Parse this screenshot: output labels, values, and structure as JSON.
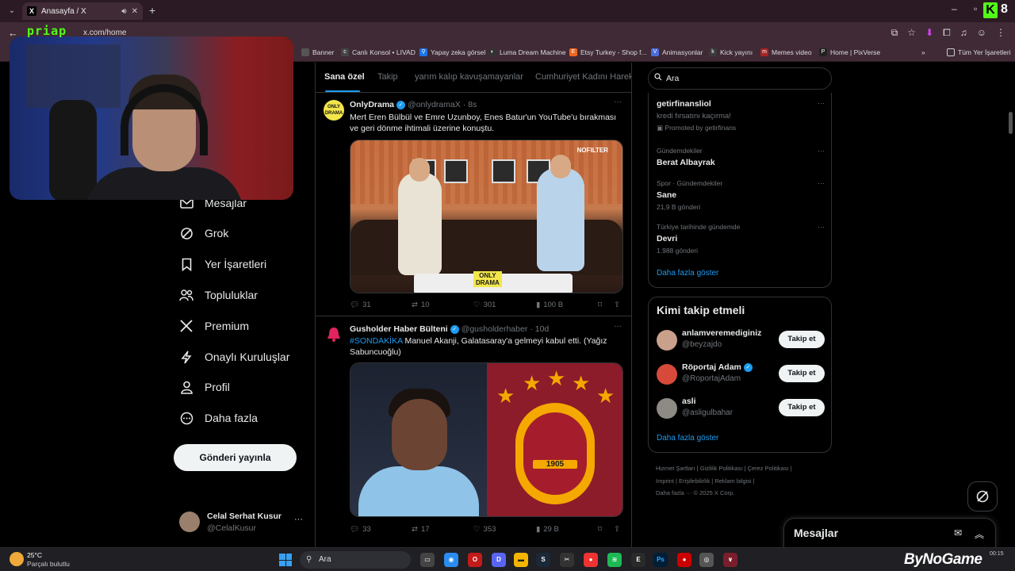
{
  "browser": {
    "tab_title": "Anasayfa / X",
    "tab_icon": "x-logo-icon",
    "url": "x.com/home",
    "kick_count": "8",
    "bookmarks": [
      {
        "label": "Banner",
        "icon": "bookmark-icon",
        "color": "#5a5a5a"
      },
      {
        "label": "Canlı Konsol • LIVAD",
        "icon": "console-icon",
        "color": "#444"
      },
      {
        "label": "Yapay zeka görsel",
        "icon": "search-icon",
        "color": "#1a73e8"
      },
      {
        "label": "Luma Dream Machine",
        "icon": "luma-icon",
        "color": "#333"
      },
      {
        "label": "Etsy Turkey - Shop f...",
        "icon": "etsy-icon",
        "color": "#f1641e"
      },
      {
        "label": "Animasyonlar",
        "icon": "vector-icon",
        "color": "#4b6bdc"
      },
      {
        "label": "Kick yayını",
        "icon": "kick-icon",
        "color": "#3a3a3a"
      },
      {
        "label": "Memes video",
        "icon": "meme-icon",
        "color": "#a22"
      },
      {
        "label": "Home | PixVerse",
        "icon": "pixverse-icon",
        "color": "#222"
      }
    ],
    "all_bookmarks": "Tüm Yer İşaretleri"
  },
  "stream": {
    "overlay_tag": "priap"
  },
  "nav": {
    "items": [
      {
        "label": "Mesajlar",
        "icon": "envelope-icon"
      },
      {
        "label": "Grok",
        "icon": "grok-icon"
      },
      {
        "label": "Yer İşaretleri",
        "icon": "bookmark-icon"
      },
      {
        "label": "Topluluklar",
        "icon": "people-icon"
      },
      {
        "label": "Premium",
        "icon": "x-logo-icon"
      },
      {
        "label": "Onaylı Kuruluşlar",
        "icon": "lightning-icon"
      },
      {
        "label": "Profil",
        "icon": "person-icon"
      },
      {
        "label": "Daha fazla",
        "icon": "more-circle-icon"
      }
    ],
    "post_button": "Gönderi yayınla",
    "account": {
      "name": "Celal Serhat Kusur",
      "handle": "@CelalKusur",
      "more": "···"
    }
  },
  "feed": {
    "tabs": [
      "Sana özel",
      "Takip",
      "yarım kalıp kavuşamayanlar",
      "Cumhuriyet Kadını Hareke"
    ],
    "tweets": [
      {
        "name": "OnlyDrama",
        "handle": "@onlydramaX",
        "time": "· 8s",
        "text": "Mert Eren Bülbül ve Emre Uzunboy, Enes Batur'un YouTube'u bırakması ve geri dönme ihtimali üzerine konuştu.",
        "avatar_label": "ONLY\nDRAMA",
        "media_label": "NOFILTER",
        "media_brand": "ONLY\nDRAMA",
        "replies": "31",
        "reposts": "10",
        "likes": "301",
        "views": "100 B"
      },
      {
        "name": "Gusholder Haber Bülteni",
        "handle": "@gusholderhaber",
        "time": "· 10d",
        "hashtag": "#SONDAKİKA",
        "text": " Manuel Akanji, Galatasaray'a gelmeyi kabul etti. (Yağız Sabuncuoğlu)",
        "emblem_year": "1905",
        "replies": "33",
        "reposts": "17",
        "likes": "353",
        "views": "29 B"
      }
    ]
  },
  "right": {
    "search_value": "Ara",
    "trends": [
      {
        "title": "getirfinansliol",
        "sub": "kredi fırsatını kaçırma!",
        "promo": "Promoted by getirfinans"
      },
      {
        "category": "Gündemdekiler",
        "title": "Berat Albayrak"
      },
      {
        "category": "Spor · Gündemdekiler",
        "title": "Sane",
        "posts": "21,9 B gönderi"
      },
      {
        "category": "Türkiye tarihinde gündemde",
        "title": "Devri",
        "posts": "1.988 gönderi"
      }
    ],
    "trends_show_more": "Daha fazla göster",
    "who_to_follow": {
      "title": "Kimi takip etmeli",
      "users": [
        {
          "name": "anlamveremediginiz",
          "handle": "@beyzajdo",
          "verified": false,
          "button": "Takip et"
        },
        {
          "name": "Röportaj Adam",
          "handle": "@RoportajAdam",
          "verified": true,
          "button": "Takip et"
        },
        {
          "name": "asli",
          "handle": "@asligulbahar",
          "verified": false,
          "button": "Takip et"
        }
      ],
      "show_more": "Daha fazla göster"
    },
    "footer": {
      "line1": "Hizmet Şartları  |  Gizlilik Politikası  |  Çerez Politikası  |",
      "line2": "Imprint  |  Erişilebilirlik  |  Reklam bilgisi  |",
      "line3": "Daha fazla ···   © 2025 X Corp."
    },
    "dm_drawer": "Mesajlar"
  },
  "taskbar": {
    "temperature": "25°C",
    "weather": "Parçalı bulutlu",
    "search": "Ara",
    "watermark": "ByNoGame",
    "clock": "00:15"
  },
  "colors": {
    "accent": "#1d9bf0",
    "background": "#000000",
    "border": "#2f3336",
    "kick": "#53fc18"
  }
}
